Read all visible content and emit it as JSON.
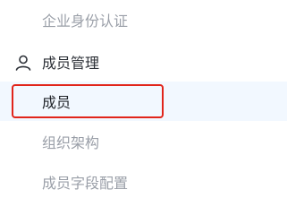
{
  "menu": {
    "enterprise_auth": "企业身份认证",
    "group_label": "成员管理",
    "group_icon": "user-icon",
    "items": [
      {
        "label": "成员",
        "active": true
      },
      {
        "label": "组织架构",
        "active": false
      },
      {
        "label": "成员字段配置",
        "active": false
      }
    ]
  },
  "colors": {
    "active_bg": "#f2f8ff",
    "highlight_border": "#e1251b",
    "muted_text": "#9a9fa8",
    "group_text": "#2b2f36"
  }
}
